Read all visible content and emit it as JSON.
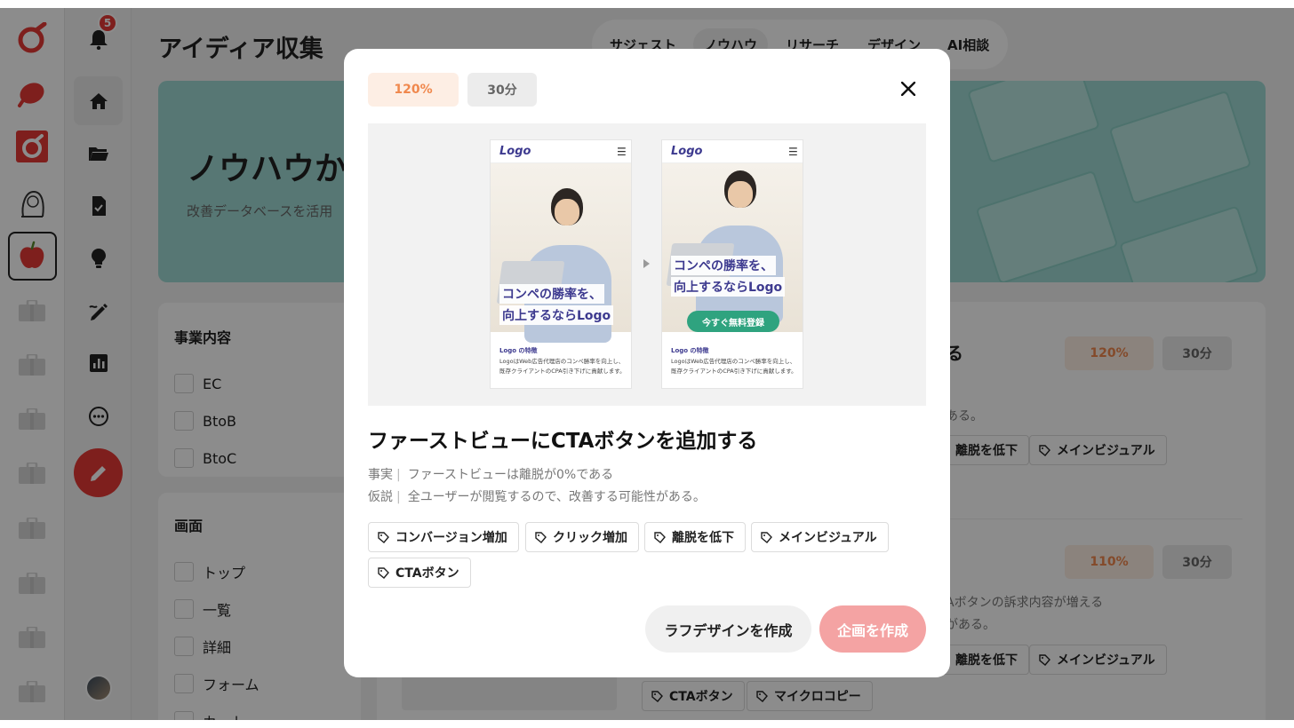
{
  "app": {
    "page_title": "アイディア収集",
    "notifications_count": "5",
    "rail_items": [
      "logo-icon",
      "red-blob-icon",
      "red-square-logo-icon",
      "sketch-avatar-icon",
      "apple-icon",
      "briefcase-icon"
    ],
    "nav_items": [
      "home-icon",
      "folder-icon",
      "document-check-icon",
      "lightbulb-icon",
      "edit-pen-icon",
      "chart-icon",
      "more-icon"
    ]
  },
  "tabs": [
    {
      "label": "サジェスト"
    },
    {
      "label": "ノウハウ"
    },
    {
      "label": "リサーチ"
    },
    {
      "label": "デザイン"
    },
    {
      "label": "AI相談"
    }
  ],
  "hero": {
    "title": "ノウハウか",
    "subtitle": "改善データベースを活用"
  },
  "filters": {
    "business": {
      "title": "事業内容",
      "options": [
        "EC",
        "BtoB",
        "BtoC"
      ]
    },
    "screen": {
      "title": "画面",
      "options": [
        "トップ",
        "一覧",
        "詳細",
        "フォーム",
        "カート"
      ]
    }
  },
  "background_list": {
    "item1": {
      "title_tail": "る",
      "rate": "120%",
      "time": "30分",
      "text_tail": "ある。",
      "tags": [
        "離脱を低下",
        "メインビジュアル"
      ]
    },
    "item2": {
      "rate": "110%",
      "time": "30分",
      "line1_tail": "Aボタンの訴求内容が増える",
      "line2_tail": "がある。",
      "tags": [
        "離脱を低下",
        "メインビジュアル",
        "CTAボタン",
        "マイクロコピー"
      ]
    }
  },
  "modal": {
    "rate": "120%",
    "time": "30分",
    "title": "ファーストビューにCTAボタンを追加する",
    "fact_label": "事実",
    "fact": "ファーストビューは離脱が0%である",
    "hypothesis_label": "仮説",
    "hypothesis": "全ユーザーが閲覧するので、改善する可能性がある。",
    "tags": [
      "コンバージョン増加",
      "クリック増加",
      "離脱を低下",
      "メインビジュアル",
      "CTAボタン"
    ],
    "rough_design_label": "ラフデザインを作成",
    "create_plan_label": "企画を作成",
    "mockup": {
      "logo": "Logo",
      "menu": "☰",
      "copy_line1": "コンペの勝率を、",
      "copy_line2": "向上するならLogo",
      "cta_label": "今すぐ無料登録",
      "feature_head": "Logo の特徴",
      "feature_line1": "LogoはWeb広告代理店のコンペ勝率を向上し、",
      "feature_line2": "既存クライアントのCPA引き下げに貢献します。"
    }
  },
  "colors": {
    "accent_red": "#e53935",
    "hero_teal": "#9fd9d3",
    "rate_orange": "#f0884d",
    "cta_green": "#2fa37f",
    "create_plan_pink": "#f4a3a3",
    "mockup_navy": "#3d3a8f"
  }
}
